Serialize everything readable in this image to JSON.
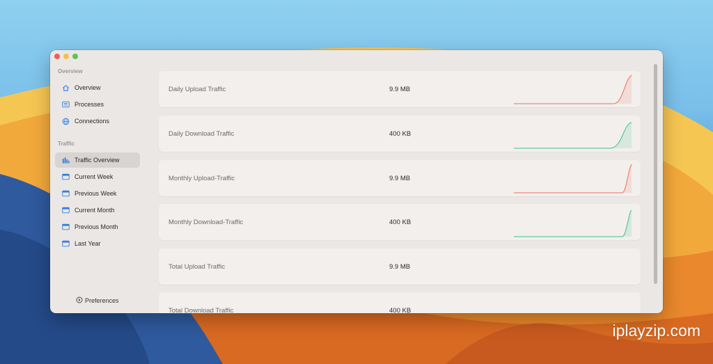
{
  "window": {
    "controls": {
      "close": "close",
      "minimize": "minimize",
      "zoom": "zoom"
    }
  },
  "sidebar": {
    "sections": [
      {
        "label": "Overview",
        "items": [
          {
            "label": "Overview",
            "icon": "house-icon"
          },
          {
            "label": "Processes",
            "icon": "list-icon"
          },
          {
            "label": "Connections",
            "icon": "globe-icon"
          }
        ]
      },
      {
        "label": "Traffic",
        "items": [
          {
            "label": "Traffic Overview",
            "icon": "bar-chart-icon",
            "selected": true
          },
          {
            "label": "Current Week",
            "icon": "calendar-icon"
          },
          {
            "label": "Previous Week",
            "icon": "calendar-icon"
          },
          {
            "label": "Current Month",
            "icon": "calendar-icon"
          },
          {
            "label": "Previous Month",
            "icon": "calendar-icon"
          },
          {
            "label": "Last Year",
            "icon": "calendar-icon"
          }
        ]
      }
    ],
    "preferences_label": "Preferences"
  },
  "traffic": {
    "cards": [
      {
        "label": "Daily Upload Traffic",
        "value": "9.9 MB",
        "sparkline": "upload"
      },
      {
        "label": "Daily Download Traffic",
        "value": "400 KB",
        "sparkline": "download"
      },
      {
        "label": "Monthly Upload-Traffic",
        "value": "9.9 MB",
        "sparkline": "upload"
      },
      {
        "label": "Monthly Download-Traffic",
        "value": "400 KB",
        "sparkline": "download"
      },
      {
        "label": "Total Upload Traffic",
        "value": "9.9 MB",
        "sparkline": "none"
      },
      {
        "label": "Total Download Traffic",
        "value": "400 KB",
        "sparkline": "none"
      }
    ]
  },
  "colors": {
    "accent": "#2f7de1",
    "upload": "#e8705f",
    "download": "#3fbf95",
    "window_bg": "#ebe7e4",
    "card_bg": "#f2efed"
  },
  "watermark": "iplayzip.com"
}
